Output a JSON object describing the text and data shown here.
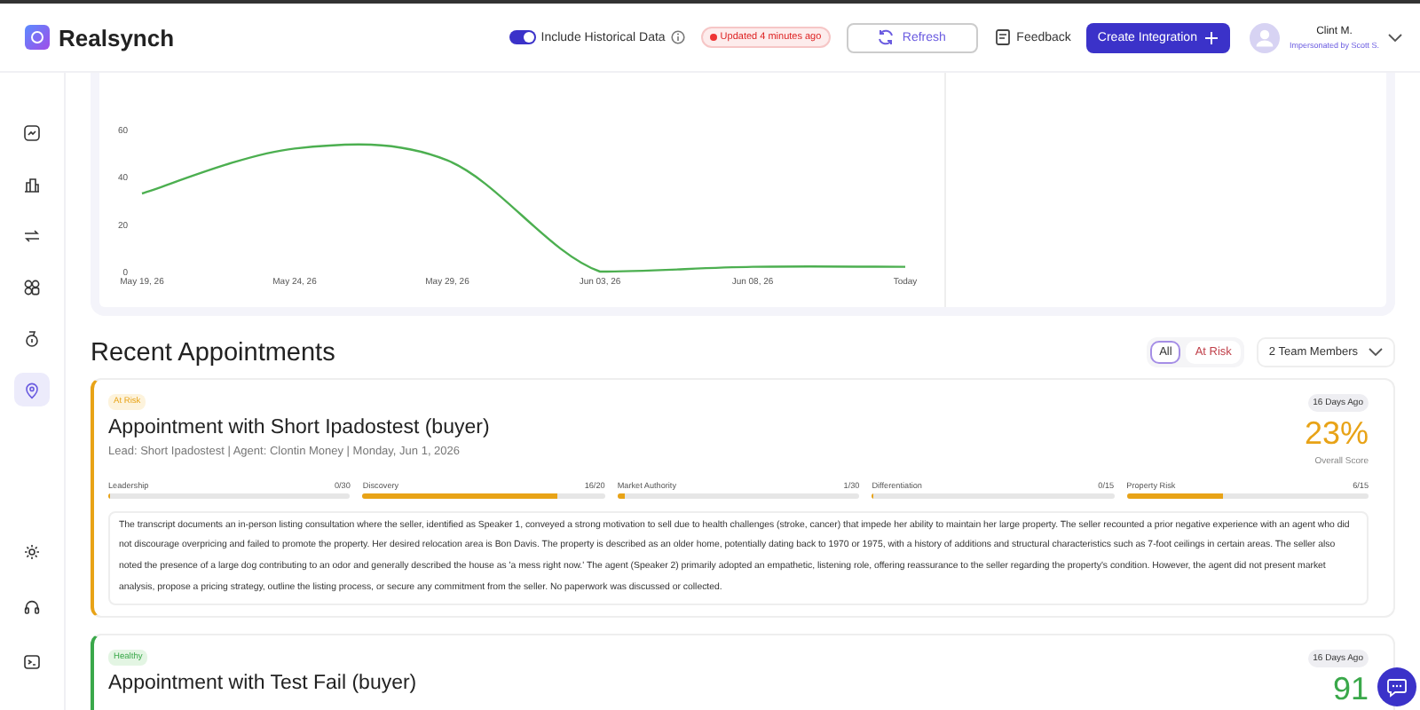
{
  "header": {
    "brand": "Realsynch",
    "historical_toggle": {
      "label": "Include Historical Data",
      "on": true
    },
    "updated_badge": "Updated 4 minutes ago",
    "refresh_button": "Refresh",
    "feedback_button": "Feedback",
    "create_button": "Create Integration",
    "user": {
      "name": "Clint M.",
      "subtitle": "Impersonated by Scott S."
    }
  },
  "sidebar": {
    "items": [
      {
        "selected": false
      },
      {
        "selected": false
      },
      {
        "selected": false
      },
      {
        "selected": false
      },
      {
        "selected": false
      },
      {
        "selected": true
      }
    ],
    "bottom_items": [
      {
        "selected": false
      },
      {
        "selected": false
      },
      {
        "selected": false
      }
    ]
  },
  "chart": {
    "chart_data": {
      "type": "line",
      "categories": [
        "May 19, 26",
        "May 24, 26",
        "May 29, 26",
        "Jun 03, 26",
        "Jun 08, 26",
        "Today"
      ],
      "yticks": [
        0,
        20,
        40,
        60
      ],
      "ylim": [
        -15,
        84
      ],
      "series": [
        {
          "color": "#4caf50",
          "values": [
            33,
            52,
            47,
            0,
            2,
            2
          ]
        }
      ]
    }
  },
  "recent": {
    "title": "Recent Appointments",
    "filters": [
      {
        "label": "All",
        "selected": true
      },
      {
        "label": "At Risk",
        "selected": false
      }
    ],
    "team_dropdown": "2 Team Members",
    "appointments": [
      {
        "kind": "at_risk",
        "status": "At Risk",
        "title": "Appointment with Short Ipadostest (buyer)",
        "meta": "Lead: Short Ipadostest | Agent: Clontin Money | Monday, Jun 1, 2026",
        "age": "16 Days Ago",
        "score": "23%",
        "score_label": "Overall Score",
        "metrics": [
          {
            "name": "Leadership",
            "value": "0/30",
            "level": 0
          },
          {
            "name": "Discovery",
            "value": "16/20",
            "level": 0.8
          },
          {
            "name": "Market Authority",
            "value": "1/30",
            "level": 0.03
          },
          {
            "name": "Differentiation",
            "value": "0/15",
            "level": 0
          },
          {
            "name": "Property Risk",
            "value": "6/15",
            "level": 0.4
          }
        ],
        "summary": "The transcript documents an in-person listing consultation where the seller, identified as Speaker 1, conveyed a strong motivation to sell due to health challenges (stroke, cancer) that impede her ability to maintain her large property. The seller recounted a prior negative experience with an agent who did not discourage overpricing and failed to promote the property. Her desired relocation area is Bon Davis. The property is described as an older home, potentially dating back to 1970 or 1975, with a history of additions and structural characteristics such as 7-foot ceilings in certain areas. The seller also noted the presence of a large dog contributing to an odor and generally described the house as 'a mess right now.' The agent (Speaker 2) primarily adopted an empathetic, listening role, offering reassurance to the seller regarding the property's condition. However, the agent did not present market analysis, propose a pricing strategy, outline the listing process, or secure any commitment from the seller. No paperwork was discussed or collected."
      },
      {
        "kind": "healthy",
        "status": "Healthy",
        "title": "Appointment with Test Fail (buyer)",
        "age": "16 Days Ago",
        "score": "91"
      }
    ]
  }
}
